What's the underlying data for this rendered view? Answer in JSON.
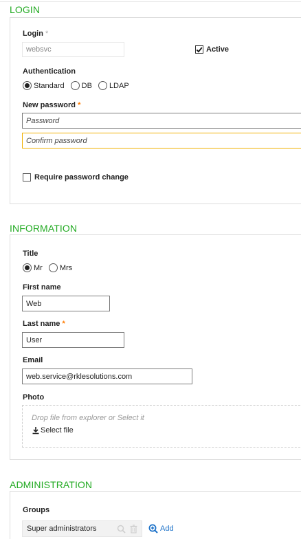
{
  "login": {
    "section_title": "LOGIN",
    "login_label": "Login",
    "login_required_mark": "*",
    "login_value": "websvc",
    "active_label": "Active",
    "active_checked": true,
    "auth_label": "Authentication",
    "auth_options": [
      "Standard",
      "DB",
      "LDAP"
    ],
    "auth_selected": "Standard",
    "new_password_label": "New password",
    "required_mark": "*",
    "password_placeholder": "Password",
    "confirm_placeholder": "Confirm password",
    "require_change_label": "Require password change",
    "require_change_checked": false
  },
  "information": {
    "section_title": "INFORMATION",
    "title_label": "Title",
    "title_options": [
      "Mr",
      "Mrs"
    ],
    "title_selected": "Mr",
    "first_name_label": "First name",
    "first_name_value": "Web",
    "last_name_label": "Last name",
    "required_mark": "*",
    "last_name_value": "User",
    "email_label": "Email",
    "email_value": "web.service@rklesolutions.com",
    "photo_label": "Photo",
    "drop_text": "Drop file from explorer or Select it",
    "select_file_label": "Select file"
  },
  "administration": {
    "section_title": "ADMINISTRATION",
    "groups_label": "Groups",
    "groups": [
      "Super administrators"
    ],
    "add_label": "Add"
  },
  "colors": {
    "section_title": "#22aa22",
    "required": "#ff7b00",
    "focus_border": "#f1b000",
    "link": "#1a70c8"
  }
}
